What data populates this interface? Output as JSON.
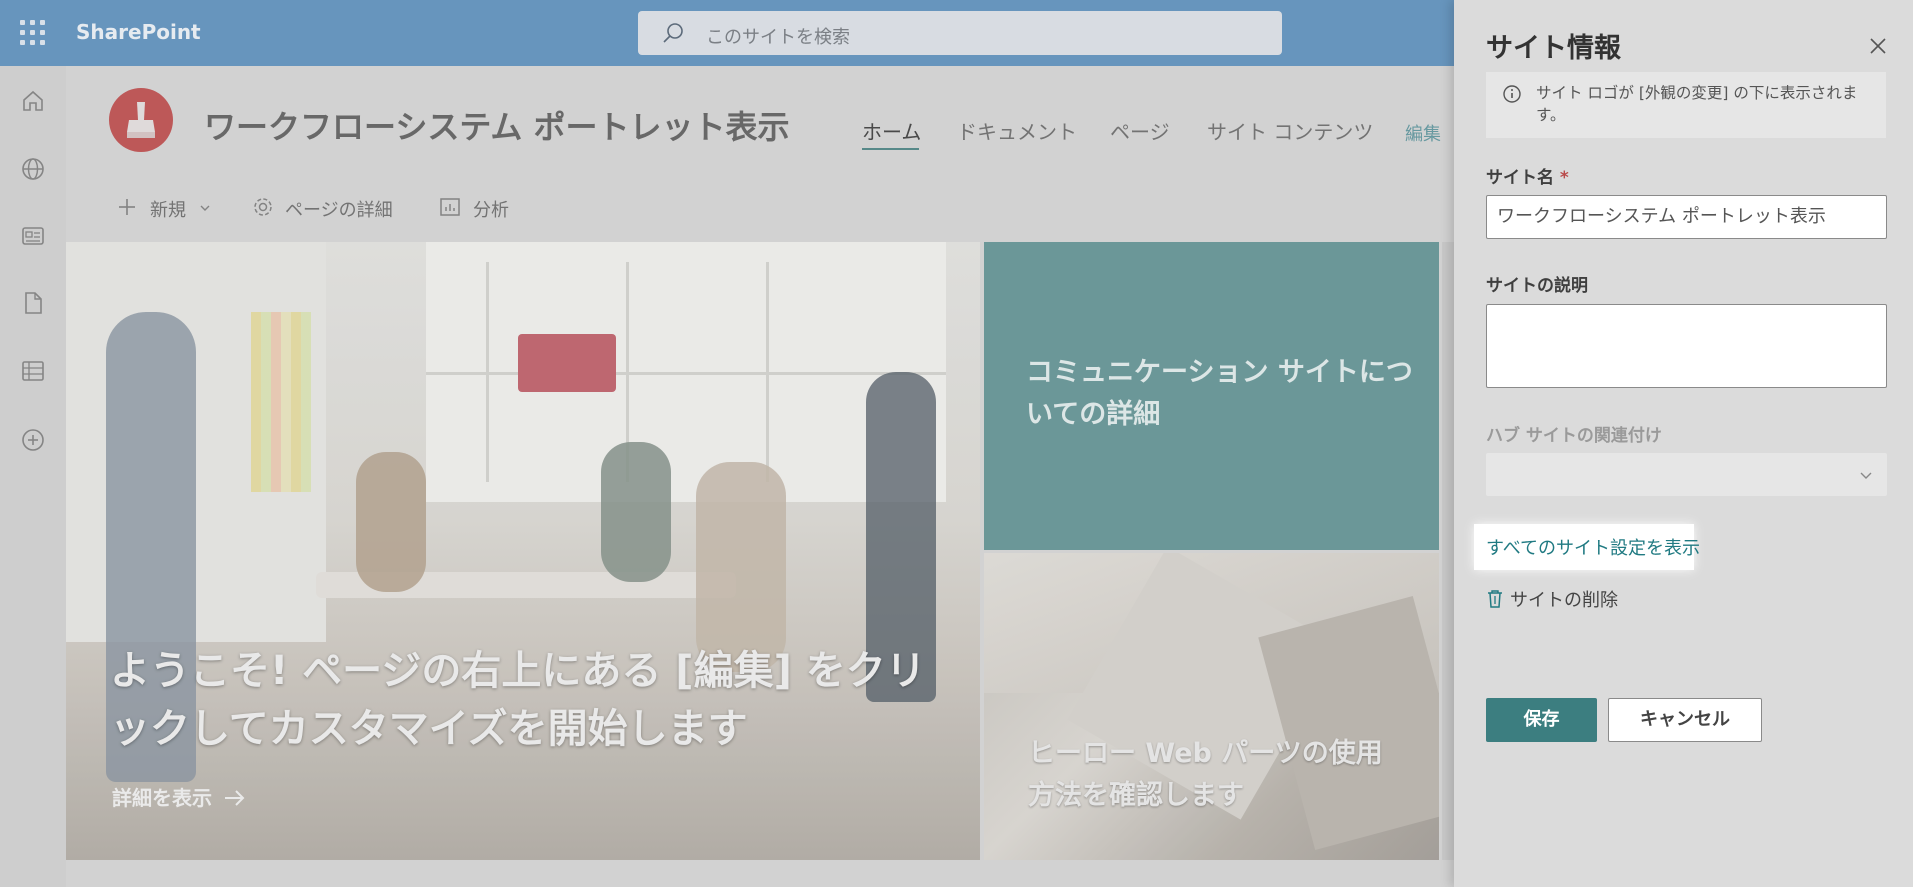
{
  "suite": {
    "brand": "SharePoint",
    "search_placeholder": "このサイトを検索"
  },
  "site": {
    "title": "ワークフローシステム ポートレット表示",
    "nav": [
      "ホーム",
      "ドキュメント",
      "ページ",
      "サイト コンテンツ",
      "編集"
    ]
  },
  "commands": {
    "new": "新規",
    "page_details": "ページの詳細",
    "analytics": "分析"
  },
  "hero": {
    "main_title": "ようこそ! ページの右上にある [編集] をクリックしてカスタマイズを開始します",
    "main_link": "詳細を表示",
    "tile1_title": "コミュニケーション サイトについての詳細",
    "tile2_title": "ヒーロー Web パーツの使用方法を確認します"
  },
  "panel": {
    "title": "サイト情報",
    "info": "サイト ロゴが [外観の変更] の下に表示されます。",
    "site_name_label": "サイト名",
    "required_mark": "*",
    "site_name_value": "ワークフローシステム ポートレット表示",
    "description_label": "サイトの説明",
    "hub_label": "ハブ サイトの関連付け",
    "all_settings_link": "すべてのサイト設定を表示",
    "delete_label": "サイトの削除",
    "save": "保存",
    "cancel": "キャンセル"
  },
  "colors": {
    "suitebar": "#6b9ac4",
    "accent": "#207a82",
    "save_button": "#3c7e80",
    "teal_tile": "#6f9c9d"
  },
  "icons": [
    "waffle-icon",
    "search-icon",
    "home-icon",
    "globe-icon",
    "news-icon",
    "file-icon",
    "list-icon",
    "add-circle-icon",
    "plus-icon",
    "chevron-down-icon",
    "gear-icon",
    "chart-icon",
    "arrow-right-icon",
    "close-icon",
    "info-icon",
    "trash-icon"
  ]
}
